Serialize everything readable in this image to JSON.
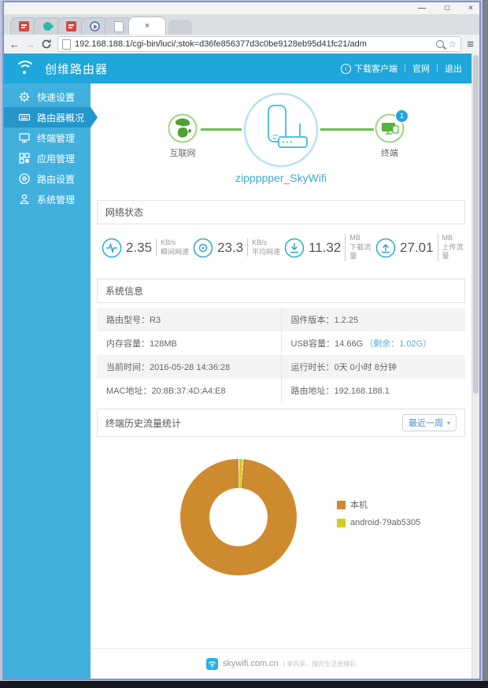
{
  "browser": {
    "url": "192.168.188.1/cgi-bin/luci/;stok=d36fe856377d3c0be9128eb95d41fc21/adm",
    "controls": {
      "minimize": "—",
      "maximize": "□",
      "close": "×"
    },
    "tabs": {
      "favicons": [
        "red-app",
        "teal-plant",
        "red-app",
        "play-button",
        "blank-page"
      ],
      "active_close": "×"
    },
    "nav": {
      "back": "←",
      "forward": "→",
      "menu": "≡",
      "star": "☆"
    }
  },
  "app_header": {
    "title": "创维路由器",
    "download_glyph": "↓",
    "links": [
      "下载客户端",
      "官网",
      "退出"
    ]
  },
  "sidebar": {
    "items": [
      {
        "label": "快速设置",
        "active": false
      },
      {
        "label": "路由器概况",
        "active": true
      },
      {
        "label": "终端管理",
        "active": false
      },
      {
        "label": "应用管理",
        "active": false
      },
      {
        "label": "路由设置",
        "active": false
      },
      {
        "label": "系统管理",
        "active": false
      }
    ]
  },
  "topology": {
    "internet_label": "互联网",
    "terminal_label": "终端",
    "terminal_badge": "1",
    "ssid": "zippppper_SkyWifi"
  },
  "network_status": {
    "title": "网络状态",
    "stats": [
      {
        "icon": "pulse-icon",
        "value": "2.35",
        "unit": "KB/s",
        "label": "瞬间网速"
      },
      {
        "icon": "average-speed-icon",
        "value": "23.3",
        "unit": "KB/s",
        "label": "平均网速"
      },
      {
        "icon": "download-icon",
        "value": "11.32",
        "unit": "MB",
        "label": "下载流量"
      },
      {
        "icon": "upload-icon",
        "value": "27.01",
        "unit": "MB",
        "label": "上传流量"
      }
    ]
  },
  "system_info": {
    "title": "系统信息",
    "rows": [
      {
        "left": "路由型号：R3",
        "right": "固件版本：1.2.25"
      },
      {
        "left": "内存容量：128MB",
        "right": "USB容量：14.66G",
        "right_extra": "（剩余：1.02G）"
      },
      {
        "left": "当前时间：2016-05-28 14:36:28",
        "right": "运行时长：0天 0小时 8分钟"
      },
      {
        "left": "MAC地址：20:8B:37:4D:A4:E8",
        "right": "路由地址：192.168.188.1"
      }
    ]
  },
  "traffic": {
    "title": "终端历史流量统计",
    "range_selector": "最近一周",
    "caret": "▾"
  },
  "chart_data": {
    "type": "pie",
    "donut": true,
    "title": "终端历史流量统计",
    "labels": [
      "本机",
      "android-79ab5305"
    ],
    "values": [
      99,
      1
    ],
    "unit": "percent-estimated",
    "colors": [
      "#ce8a2e",
      "#d4c929"
    ],
    "legend_position": "right"
  },
  "footer": {
    "site": "skywifi.com.cn",
    "slogan": "| 享风采，慢的生活更精彩"
  },
  "colors": {
    "header_blue": "#1fa6da",
    "sidebar_blue": "#41b0dc",
    "active_item_blue": "#2496cb",
    "accent_teal": "#2aabc8",
    "topology_green": "#6cc04a",
    "link_blue": "#3fa8d8",
    "donut_orange": "#ce8a2e",
    "legend_yellow": "#d4c929"
  }
}
